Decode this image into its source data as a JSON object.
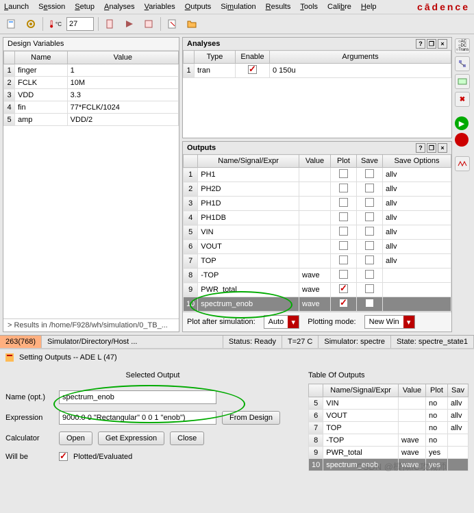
{
  "menu": {
    "items": [
      "Launch",
      "Session",
      "Setup",
      "Analyses",
      "Variables",
      "Outputs",
      "Simulation",
      "Results",
      "Tools",
      "Calibre",
      "Help"
    ],
    "brand": "cādence"
  },
  "toolbar": {
    "temp_value": "27"
  },
  "design_vars": {
    "title": "Design Variables",
    "headers": [
      "Name",
      "Value"
    ],
    "rows": [
      {
        "n": "1",
        "name": "finger",
        "value": "1"
      },
      {
        "n": "2",
        "name": "FCLK",
        "value": "10M"
      },
      {
        "n": "3",
        "name": "VDD",
        "value": "3.3"
      },
      {
        "n": "4",
        "name": "fin",
        "value": "77*FCLK/1024"
      },
      {
        "n": "5",
        "name": "amp",
        "value": "VDD/2"
      }
    ]
  },
  "analyses": {
    "title": "Analyses",
    "headers": [
      "Type",
      "Enable",
      "Arguments"
    ],
    "rows": [
      {
        "n": "1",
        "type": "tran",
        "enable": true,
        "args": "0 150u"
      }
    ]
  },
  "outputs": {
    "title": "Outputs",
    "headers": [
      "",
      "Name/Signal/Expr",
      "Value",
      "Plot",
      "Save",
      "Save Options"
    ],
    "rows": [
      {
        "n": "1",
        "name": "PH1",
        "value": "",
        "plot": false,
        "save": false,
        "opt": "allv"
      },
      {
        "n": "2",
        "name": "PH2D",
        "value": "",
        "plot": false,
        "save": false,
        "opt": "allv"
      },
      {
        "n": "3",
        "name": "PH1D",
        "value": "",
        "plot": false,
        "save": false,
        "opt": "allv"
      },
      {
        "n": "4",
        "name": "PH1DB",
        "value": "",
        "plot": false,
        "save": false,
        "opt": "allv"
      },
      {
        "n": "5",
        "name": "VIN",
        "value": "",
        "plot": false,
        "save": false,
        "opt": "allv"
      },
      {
        "n": "6",
        "name": "VOUT",
        "value": "",
        "plot": false,
        "save": false,
        "opt": "allv"
      },
      {
        "n": "7",
        "name": "TOP",
        "value": "",
        "plot": false,
        "save": false,
        "opt": "allv"
      },
      {
        "n": "8",
        "name": "-TOP",
        "value": "wave",
        "plot": false,
        "save": false,
        "opt": ""
      },
      {
        "n": "9",
        "name": "PWR_total",
        "value": "wave",
        "plot": true,
        "save": false,
        "opt": ""
      },
      {
        "n": "10",
        "name": "spectrum_enob",
        "value": "wave",
        "plot": true,
        "save": false,
        "opt": "",
        "selected": true
      }
    ],
    "plot_after_label": "Plot after simulation:",
    "plot_after_value": "Auto",
    "plot_mode_label": "Plotting mode:",
    "plot_mode_value": "New Win"
  },
  "results_line": "> Results in /home/F928/wh/simulation/0_TB_...",
  "statusbar": {
    "mouse": "263(768)",
    "path": "Simulator/Directory/Host ...",
    "status": "Status: Ready",
    "temp": "T=27 C",
    "sim": "Simulator: spectre",
    "state": "State: spectre_state1"
  },
  "dialog": {
    "title": "Setting Outputs -- ADE L (47)",
    "selected_output_label": "Selected Output",
    "table_label": "Table Of Outputs",
    "name_label": "Name (opt.)",
    "name_value": "spectrum_enob",
    "expr_label": "Expression",
    "expr_value": "9000.0 0 \"Rectangular\" 0 0 1 \"enob\")",
    "from_design": "From Design",
    "calc_label": "Calculator",
    "open": "Open",
    "get_expr": "Get Expression",
    "close": "Close",
    "willbe_label": "Will be",
    "plotted_label": "Plotted/Evaluated",
    "table_headers": [
      "",
      "Name/Signal/Expr",
      "Value",
      "Plot",
      "Sav"
    ],
    "table_rows": [
      {
        "n": "5",
        "name": "VIN",
        "value": "",
        "plot": "no",
        "save": "allv"
      },
      {
        "n": "6",
        "name": "VOUT",
        "value": "",
        "plot": "no",
        "save": "allv"
      },
      {
        "n": "7",
        "name": "TOP",
        "value": "",
        "plot": "no",
        "save": "allv"
      },
      {
        "n": "8",
        "name": "-TOP",
        "value": "wave",
        "plot": "no",
        "save": ""
      },
      {
        "n": "9",
        "name": "PWR_total",
        "value": "wave",
        "plot": "yes",
        "save": ""
      },
      {
        "n": "10",
        "name": "spectrum_enob",
        "value": "wave",
        "plot": "yes",
        "save": "",
        "selected": true
      }
    ]
  },
  "watermark": "CSDN @模拟IC攻城师"
}
